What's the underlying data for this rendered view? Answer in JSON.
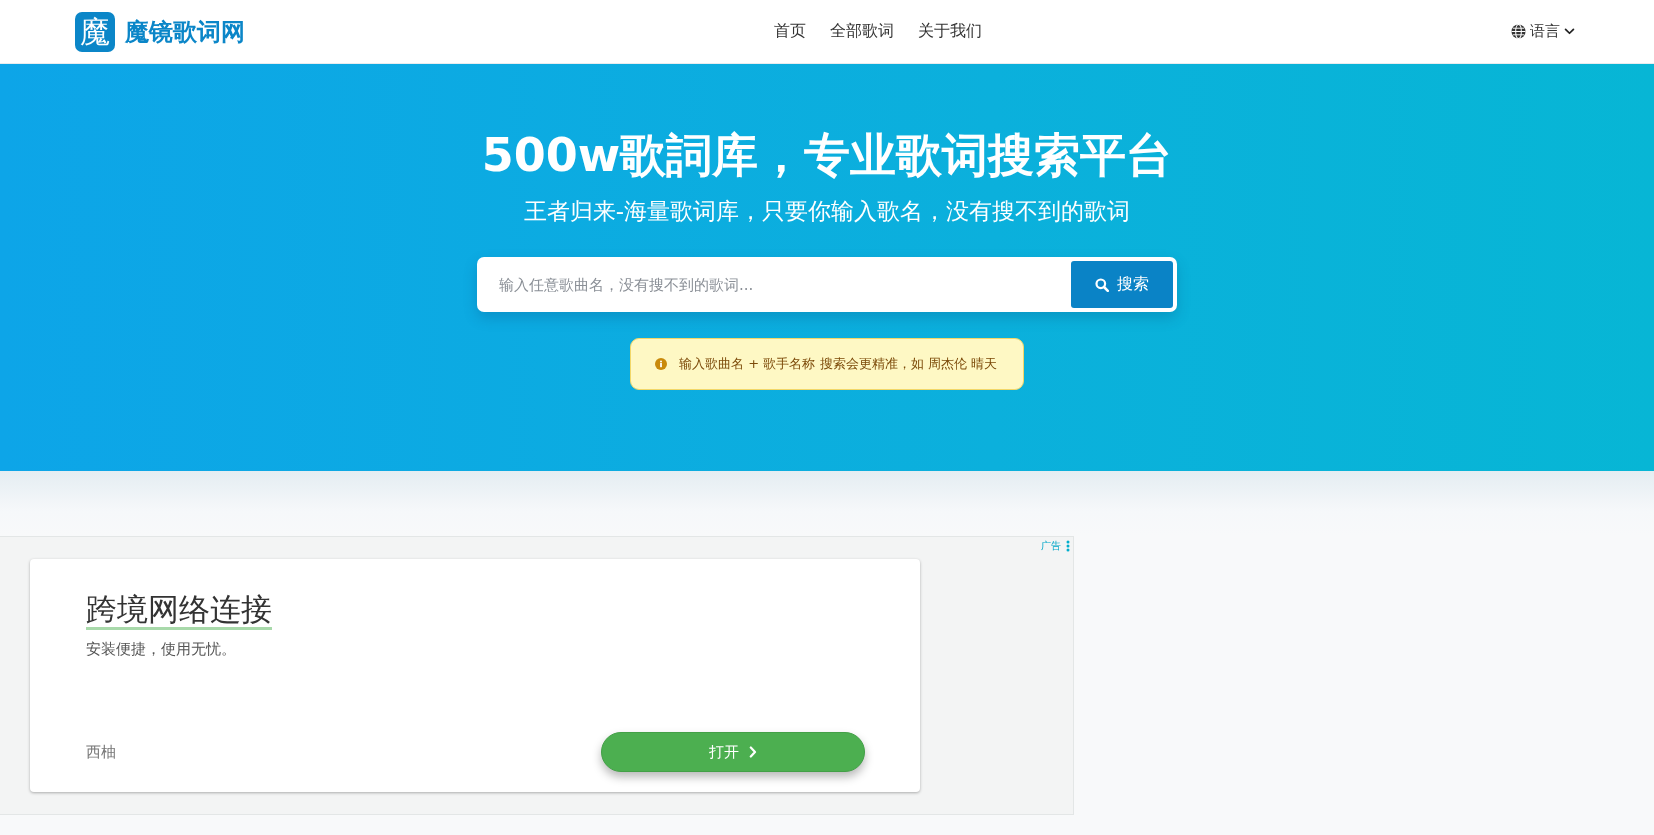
{
  "header": {
    "logo_mark": "魔",
    "site_name": "魔镜歌词网",
    "nav": [
      {
        "label": "首页"
      },
      {
        "label": "全部歌词"
      },
      {
        "label": "关于我们"
      }
    ],
    "language": {
      "label": "语言"
    }
  },
  "hero": {
    "title": "500w歌詞库，专业歌词搜索平台",
    "subtitle": "王者归来-海量歌词库，只要你输入歌名，没有搜不到的歌词",
    "search": {
      "placeholder": "输入任意歌曲名，没有搜不到的歌词...",
      "button": "搜索"
    },
    "tip": "输入歌曲名 + 歌手名称 搜索会更精准，如 周杰伦 晴天"
  },
  "ad": {
    "label": "广告",
    "card": {
      "title": "跨境网络连接",
      "description": "安装便捷，使用无忧。",
      "advertiser": "西柚",
      "button": "打开"
    }
  }
}
